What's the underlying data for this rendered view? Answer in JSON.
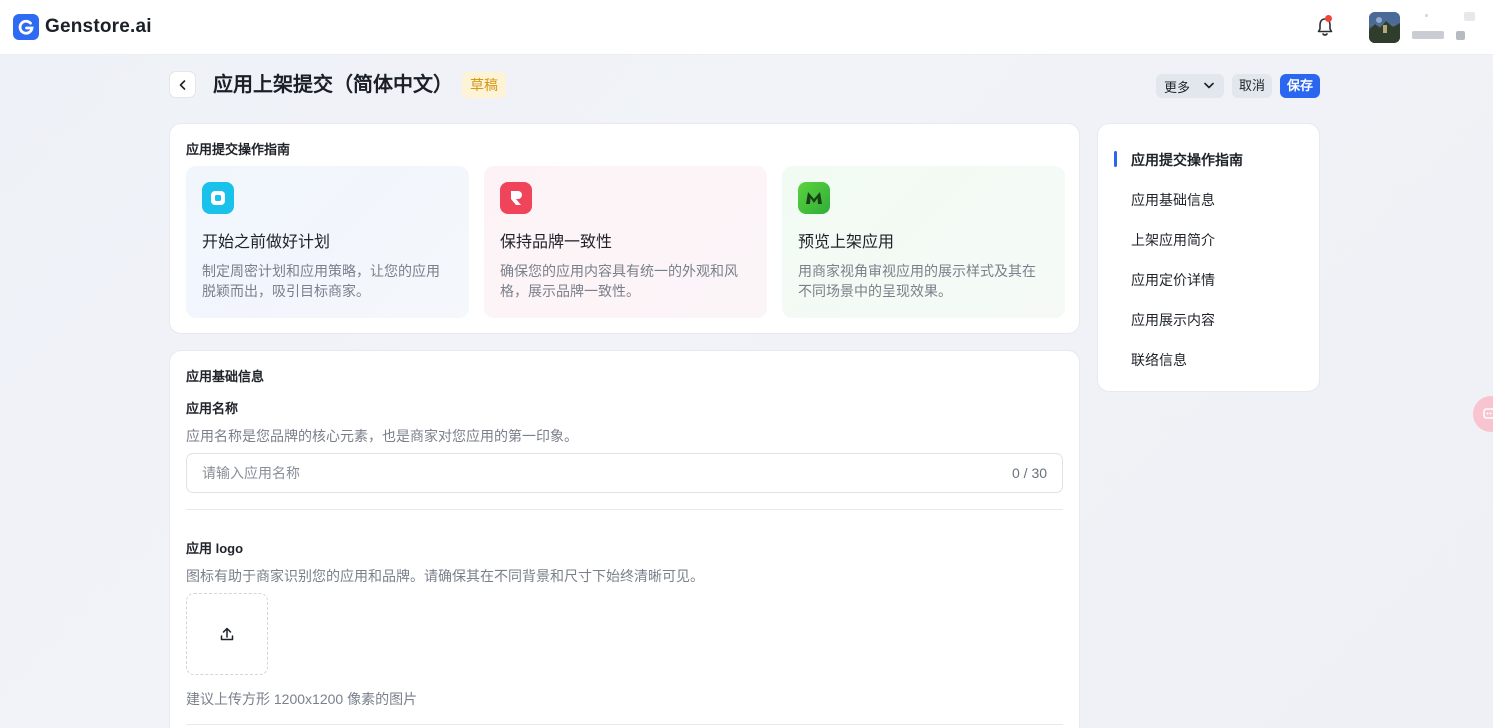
{
  "brand": {
    "name": "Genstore.ai"
  },
  "header": {
    "title": "应用上架提交（简体中文）",
    "badge": "草稿",
    "more_label": "更多",
    "cancel_label": "取消",
    "save_label": "保存"
  },
  "guide": {
    "title": "应用提交操作指南",
    "items": [
      {
        "title": "开始之前做好计划",
        "desc": "制定周密计划和应用策略，让您的应用脱颖而出，吸引目标商家。",
        "icon": "square-app-icon",
        "color": "#19c2ea"
      },
      {
        "title": "保持品牌一致性",
        "desc": "确保您的应用内容具有统一的外观和风格，展示品牌一致性。",
        "icon": "brand-r-icon",
        "color": "#f0445a"
      },
      {
        "title": "预览上架应用",
        "desc": "用商家视角审视应用的展示样式及其在不同场景中的呈现效果。",
        "icon": "preview-m-icon",
        "color": "#5bd33c"
      }
    ]
  },
  "basic_info": {
    "title": "应用基础信息",
    "name_label": "应用名称",
    "name_desc": "应用名称是您品牌的核心元素，也是商家对您应用的第一印象。",
    "name_placeholder": "请输入应用名称",
    "name_count": "0 / 30",
    "logo_label": "应用 logo",
    "logo_desc": "图标有助于商家识别您的应用和品牌。请确保其在不同背景和尺寸下始终清晰可见。",
    "logo_hint": "建议上传方形 1200x1200 像素的图片"
  },
  "toc": {
    "items": [
      "应用提交操作指南",
      "应用基础信息",
      "上架应用简介",
      "应用定价详情",
      "应用展示内容",
      "联络信息"
    ],
    "active_index": 0
  },
  "colors": {
    "accent": "#2b66f1",
    "badge_bg": "#fdf3d7",
    "badge_text": "#d89614"
  }
}
